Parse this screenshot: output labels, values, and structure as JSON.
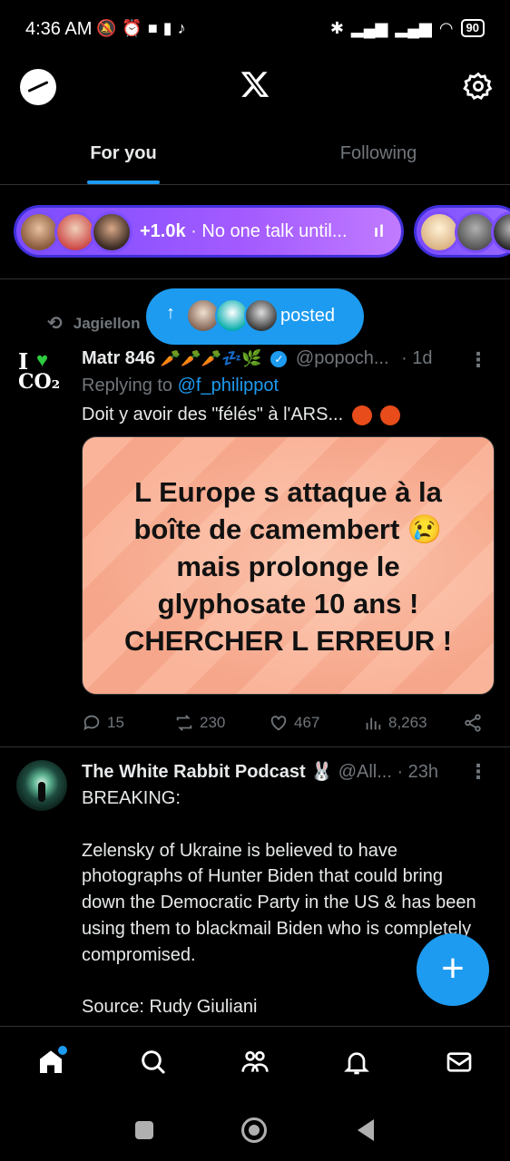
{
  "status_bar": {
    "time": "4:36 AM",
    "left_icons": [
      "bell-off-icon",
      "alarm-icon",
      "video-icon",
      "trash-icon",
      "tiktok-icon"
    ],
    "right_icons": [
      "bluetooth-icon",
      "signal-icon",
      "signal-icon",
      "wifi-icon"
    ],
    "battery": "90"
  },
  "header": {
    "logo": "X",
    "left_icon": "profile-avatar",
    "right_icon": "settings-icon"
  },
  "tabs": [
    {
      "label": "For you",
      "active": true
    },
    {
      "label": "Following",
      "active": false
    }
  ],
  "spaces": {
    "count_text": "+1.0k",
    "title": "No one talk until...",
    "separator": "·",
    "equalizer": "ıl"
  },
  "posted_pill": {
    "arrow": "↑",
    "label": "posted"
  },
  "tweet1": {
    "repost_label": "Jagiellon",
    "repost_suffix": "ed",
    "avatar_text": {
      "line1": "I",
      "line2": "CO₂"
    },
    "name": "Matr 846",
    "name_emoji": "🥕🥕🥕💤🌿",
    "handle": "@popoch...",
    "time": "· 1d",
    "replying_prefix": "Replying to",
    "replying_to": "@f_philippot",
    "text": "Doit y avoir des \"félés\" à l'ARS...",
    "media_lines": [
      "L Europe s attaque à la",
      "boîte de camembert 😢",
      "mais prolonge le",
      "glyphosate 10 ans !",
      "CHERCHER L ERREUR !"
    ],
    "replies": "15",
    "reposts": "230",
    "likes": "467",
    "views": "8,263"
  },
  "tweet2": {
    "name": "The White Rabbit Podcast 🐰",
    "handle": "@All...",
    "time": "· 23h",
    "paragraphs": [
      "BREAKING:",
      "Zelensky of Ukraine is believed to have photographs of Hunter Biden that could bring down the Democratic Party in the US & has been using them to blackmail Biden who is completely compromised.",
      "Source: Rudy Giuliani"
    ]
  },
  "fab": {
    "label": "+"
  },
  "bottom_nav": [
    "home-icon",
    "search-icon",
    "communities-icon",
    "notifications-icon",
    "messages-icon"
  ],
  "colors": {
    "accent": "#1d9bf0",
    "background": "#000000",
    "muted": "#71767b",
    "space_purple": "#7c4dff"
  }
}
